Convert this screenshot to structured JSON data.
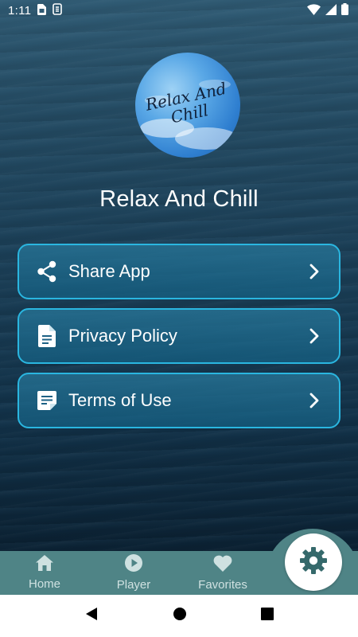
{
  "status_bar": {
    "time": "1:11",
    "icons": [
      "sim-card-icon",
      "sync-icon",
      "wifi-icon",
      "signal-icon",
      "battery-icon"
    ]
  },
  "logo": {
    "line1": "Relax And",
    "line2": "Chill"
  },
  "app_title": "Relax And Chill",
  "menu": {
    "items": [
      {
        "label": "Share App",
        "icon": "share-icon"
      },
      {
        "label": "Privacy Policy",
        "icon": "document-icon"
      },
      {
        "label": "Terms of Use",
        "icon": "note-icon"
      }
    ]
  },
  "bottom_nav": {
    "items": [
      {
        "label": "Home",
        "icon": "home-icon"
      },
      {
        "label": "Player",
        "icon": "play-circle-icon"
      },
      {
        "label": "Favorites",
        "icon": "heart-icon"
      }
    ],
    "active": "settings-icon"
  },
  "colors": {
    "accent_border": "#2ab6e0",
    "nav_background": "#4f8486",
    "nav_text": "#cfe1e1",
    "settings_icon": "#35696b"
  }
}
